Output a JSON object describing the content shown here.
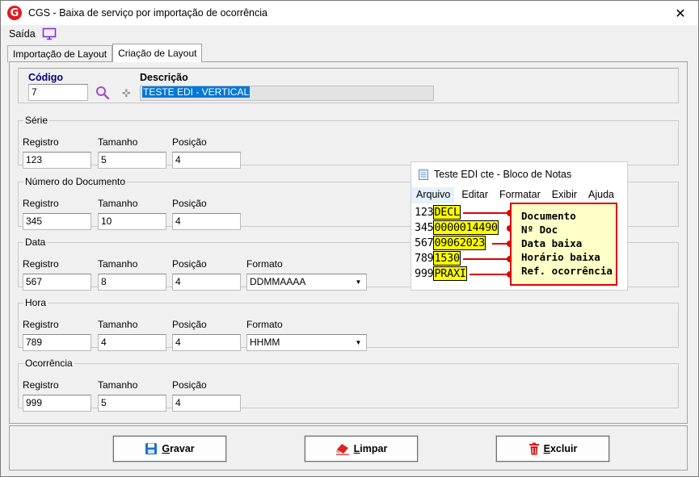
{
  "window": {
    "title": "CGS - Baixa de serviço por importação de ocorrência",
    "close_glyph": "✕",
    "logo_letter": "G"
  },
  "menu": {
    "saida": "Saída"
  },
  "tabs": [
    {
      "label": "Importação de Layout",
      "active": false
    },
    {
      "label": "Criação de Layout",
      "active": true
    }
  ],
  "header": {
    "codigo_label": "Código",
    "codigo_value": "7",
    "descricao_label": "Descrição",
    "descricao_value": "TESTE EDI - VERTICAL",
    "plus_glyph": "✜"
  },
  "field_labels": {
    "registro": "Registro",
    "tamanho": "Tamanho",
    "posicao": "Posição",
    "formato": "Formato"
  },
  "sections": {
    "serie": {
      "title": "Série",
      "registro": "123",
      "tamanho": "5",
      "posicao": "4"
    },
    "numero_documento": {
      "title": "Número do Documento",
      "registro": "345",
      "tamanho": "10",
      "posicao": "4"
    },
    "data": {
      "title": "Data",
      "registro": "567",
      "tamanho": "8",
      "posicao": "4",
      "formato": "DDMMAAAA"
    },
    "hora": {
      "title": "Hora",
      "registro": "789",
      "tamanho": "4",
      "posicao": "4",
      "formato": "HHMM"
    },
    "ocorrencia": {
      "title": "Ocorrência",
      "registro": "999",
      "tamanho": "5",
      "posicao": "4"
    }
  },
  "buttons": {
    "gravar": {
      "first": "G",
      "rest": "ravar"
    },
    "limpar": {
      "first": "L",
      "rest": "impar"
    },
    "excluir": {
      "first": "E",
      "rest": "xcluir"
    }
  },
  "notepad": {
    "title": "Teste EDI cte - Bloco de Notas",
    "menu": [
      "Arquivo",
      "Editar",
      "Formatar",
      "Exibir",
      "Ajuda"
    ],
    "lines": [
      {
        "prefix": "123",
        "highlight": "DECL"
      },
      {
        "prefix": "345",
        "highlight": "0000014490"
      },
      {
        "prefix": "567",
        "highlight": "09062023"
      },
      {
        "prefix": "789",
        "highlight": "1530"
      },
      {
        "prefix": "999",
        "highlight": "PRAXI"
      }
    ],
    "legend": [
      "Documento",
      "Nº Doc",
      "Data baixa",
      "Horário baixa",
      "Ref. ocorrência"
    ]
  },
  "colors": {
    "accent_red": "#e00000",
    "highlight_yellow": "#ffff00",
    "selection_blue": "#0078d7",
    "codigo_label": "#000080"
  }
}
